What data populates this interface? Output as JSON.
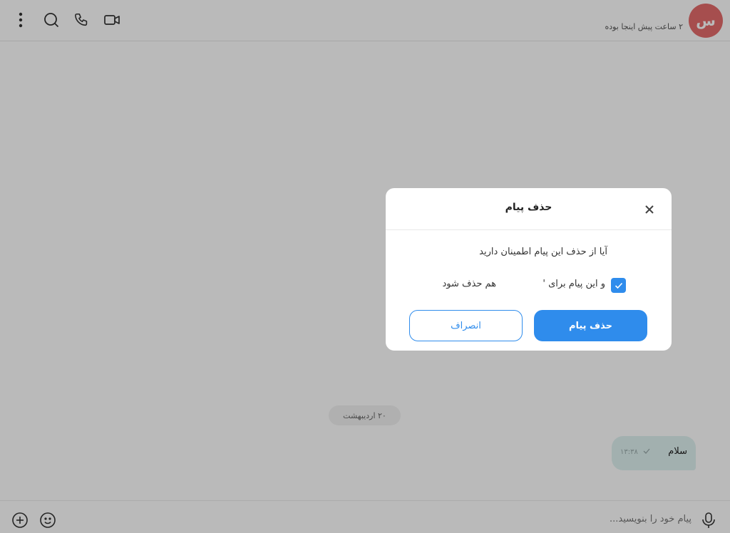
{
  "header": {
    "avatar_letter": "س",
    "last_seen": "۲ ساعت پیش اینجا بوده",
    "icons": [
      "more-vertical-icon",
      "search-icon",
      "phone-icon",
      "video-icon"
    ]
  },
  "chat": {
    "date_separator": "۲۰ اردیبهشت",
    "message": {
      "text": "سلام",
      "time": "۱۳:۳۸",
      "status_icon": "single-check-icon"
    }
  },
  "composer": {
    "placeholder": "پیام خود را بنویسید...",
    "icons": [
      "add-icon",
      "emoji-icon",
      "microphone-icon"
    ]
  },
  "modal": {
    "title": "حذف پیام",
    "question": "آیا از حذف این پیام اطمینان دارید",
    "checkbox_label": "و این پیام برای '",
    "checkbox_label_suffix": "هم حذف شود",
    "checkbox_checked": true,
    "delete_button": "حذف پیام",
    "cancel_button": "انصراف",
    "accent_color": "#2f8cec"
  }
}
